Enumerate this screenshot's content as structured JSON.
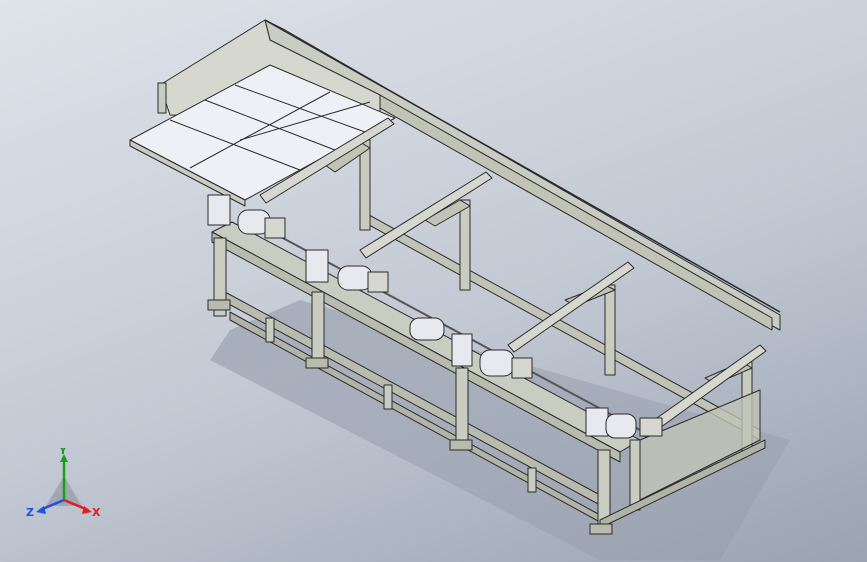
{
  "viewport": {
    "background_top": "#dfe3ea",
    "background_bottom": "#9aa3b2"
  },
  "model": {
    "frame_color": "#c9ccc0",
    "frame_edge_color": "#2b2b2b",
    "tray_color": "#eef0f6",
    "motor_color": "#e8e9ee"
  },
  "triad": {
    "x_label": "X",
    "y_label": "Y",
    "z_label": "Z",
    "x_color": "#e02020",
    "y_color": "#18a018",
    "z_color": "#2050e0"
  }
}
